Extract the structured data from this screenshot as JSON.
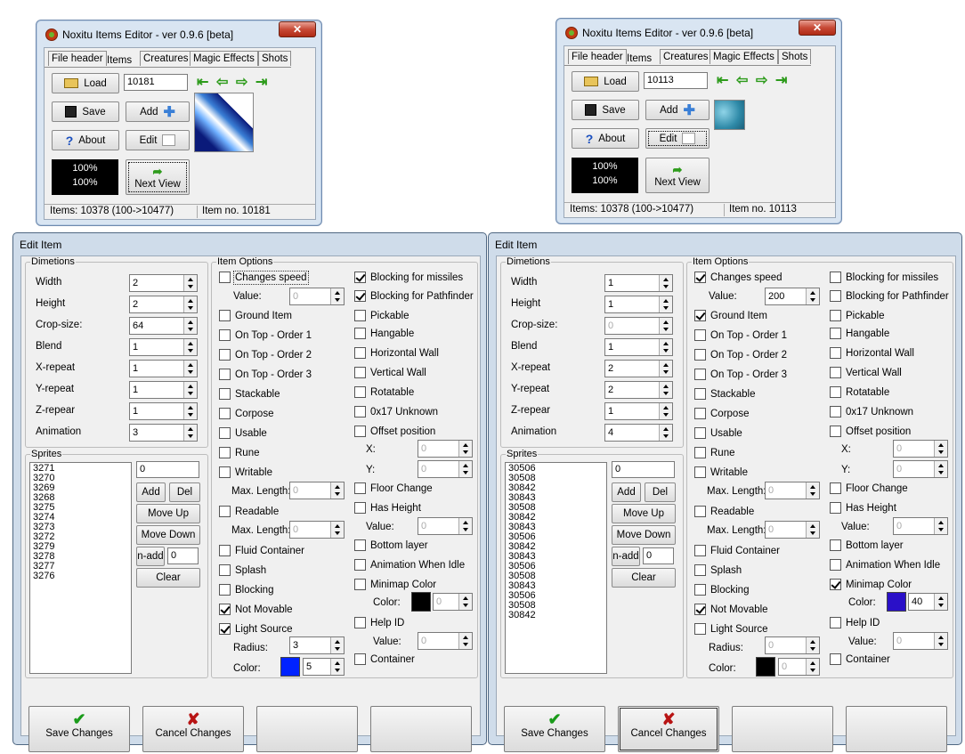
{
  "app": {
    "title": "Noxitu Items Editor - ver 0.9.6 [beta]",
    "close_glyph": "✕"
  },
  "tabs": [
    "File header",
    "Items",
    "Creatures",
    "Magic Effects",
    "Shots"
  ],
  "main_buttons": {
    "load": "Load",
    "save": "Save",
    "about": "About",
    "add": "Add",
    "edit": "Edit",
    "next_view": "Next View"
  },
  "left": {
    "item_id": "10181",
    "zoom1": "100%",
    "zoom2": "100%",
    "status_items": "Items: 10378 (100->10477)",
    "status_itemno": "Item no. 10181",
    "edit": {
      "title": "Edit Item",
      "dim_values": [
        "2",
        "2",
        "64",
        "1",
        "1",
        "1",
        "1",
        "3"
      ],
      "sprites": [
        "3271",
        "3270",
        "3269",
        "3268",
        "3275",
        "3274",
        "3273",
        "3272",
        "3279",
        "3278",
        "3277",
        "3276"
      ],
      "sprite_input": "0",
      "n_add": "0",
      "changes_speed_value": "0",
      "readable_len1": "0",
      "readable_len2": "0",
      "offset_x": "0",
      "offset_y": "0",
      "height_value": "0",
      "minimap_value": "0",
      "help_value": "0",
      "light_radius": "3",
      "light_color_value": "5",
      "light_color": "#0022ff",
      "minimap_color": "#000000"
    }
  },
  "right": {
    "item_id": "10113",
    "zoom1": "100%",
    "zoom2": "100%",
    "status_items": "Items: 10378 (100->10477)",
    "status_itemno": "Item no. 10113",
    "edit": {
      "title": "Edit Item",
      "dim_values": [
        "1",
        "1",
        "0",
        "1",
        "2",
        "2",
        "1",
        "4"
      ],
      "sprites": [
        "30506",
        "30508",
        "30842",
        "30843",
        "30508",
        "30842",
        "30843",
        "30506",
        "30842",
        "30843",
        "30506",
        "30508",
        "30843",
        "30506",
        "30508",
        "30842"
      ],
      "sprite_input": "0",
      "n_add": "0",
      "changes_speed_value": "200",
      "readable_len1": "0",
      "readable_len2": "0",
      "offset_x": "0",
      "offset_y": "0",
      "height_value": "0",
      "minimap_value": "40",
      "help_value": "0",
      "light_radius": "0",
      "light_color_value": "0",
      "light_color": "#000000",
      "minimap_color": "#2a10c8"
    }
  },
  "labels": {
    "dimetions": "Dimetions",
    "dims": [
      "Width",
      "Height",
      "Crop-size:",
      "Blend",
      "X-repeat",
      "Y-repeat",
      "Z-repear",
      "Animation"
    ],
    "sprites": "Sprites",
    "item_options": "Item Options",
    "value": "Value:",
    "max_length": "Max. Length:",
    "radius": "Radius:",
    "color": "Color:",
    "x": "X:",
    "y": "Y:",
    "add": "Add",
    "del": "Del",
    "move_up": "Move Up",
    "move_down": "Move Down",
    "n_add": "n-add",
    "clear": "Clear",
    "save_changes": "Save Changes",
    "cancel_changes": "Cancel Changes"
  },
  "options_col1": [
    "Changes speed",
    "Ground Item",
    "On Top - Order 1",
    "On Top - Order 2",
    "On Top - Order 3",
    "Stackable",
    "Corpose",
    "Usable",
    "Rune",
    "Writable",
    "Readable",
    "Fluid Container",
    "Splash",
    "Blocking",
    "Not Movable",
    "Light Source"
  ],
  "options_col2": [
    "Blocking for missiles",
    "Blocking for Pathfinder",
    "Pickable",
    "Hangable",
    "Horizontal Wall",
    "Vertical Wall",
    "Rotatable",
    "0x17 Unknown",
    "Offset position",
    "Floor Change",
    "Has Height",
    "Bottom layer",
    "Animation When Idle",
    "Minimap Color",
    "Help ID",
    "Container"
  ],
  "checked_left": [
    "Not Movable",
    "Light Source",
    "Blocking for missiles",
    "Blocking for Pathfinder"
  ],
  "checked_right": [
    "Changes speed",
    "Ground Item",
    "Not Movable",
    "Minimap Color"
  ]
}
